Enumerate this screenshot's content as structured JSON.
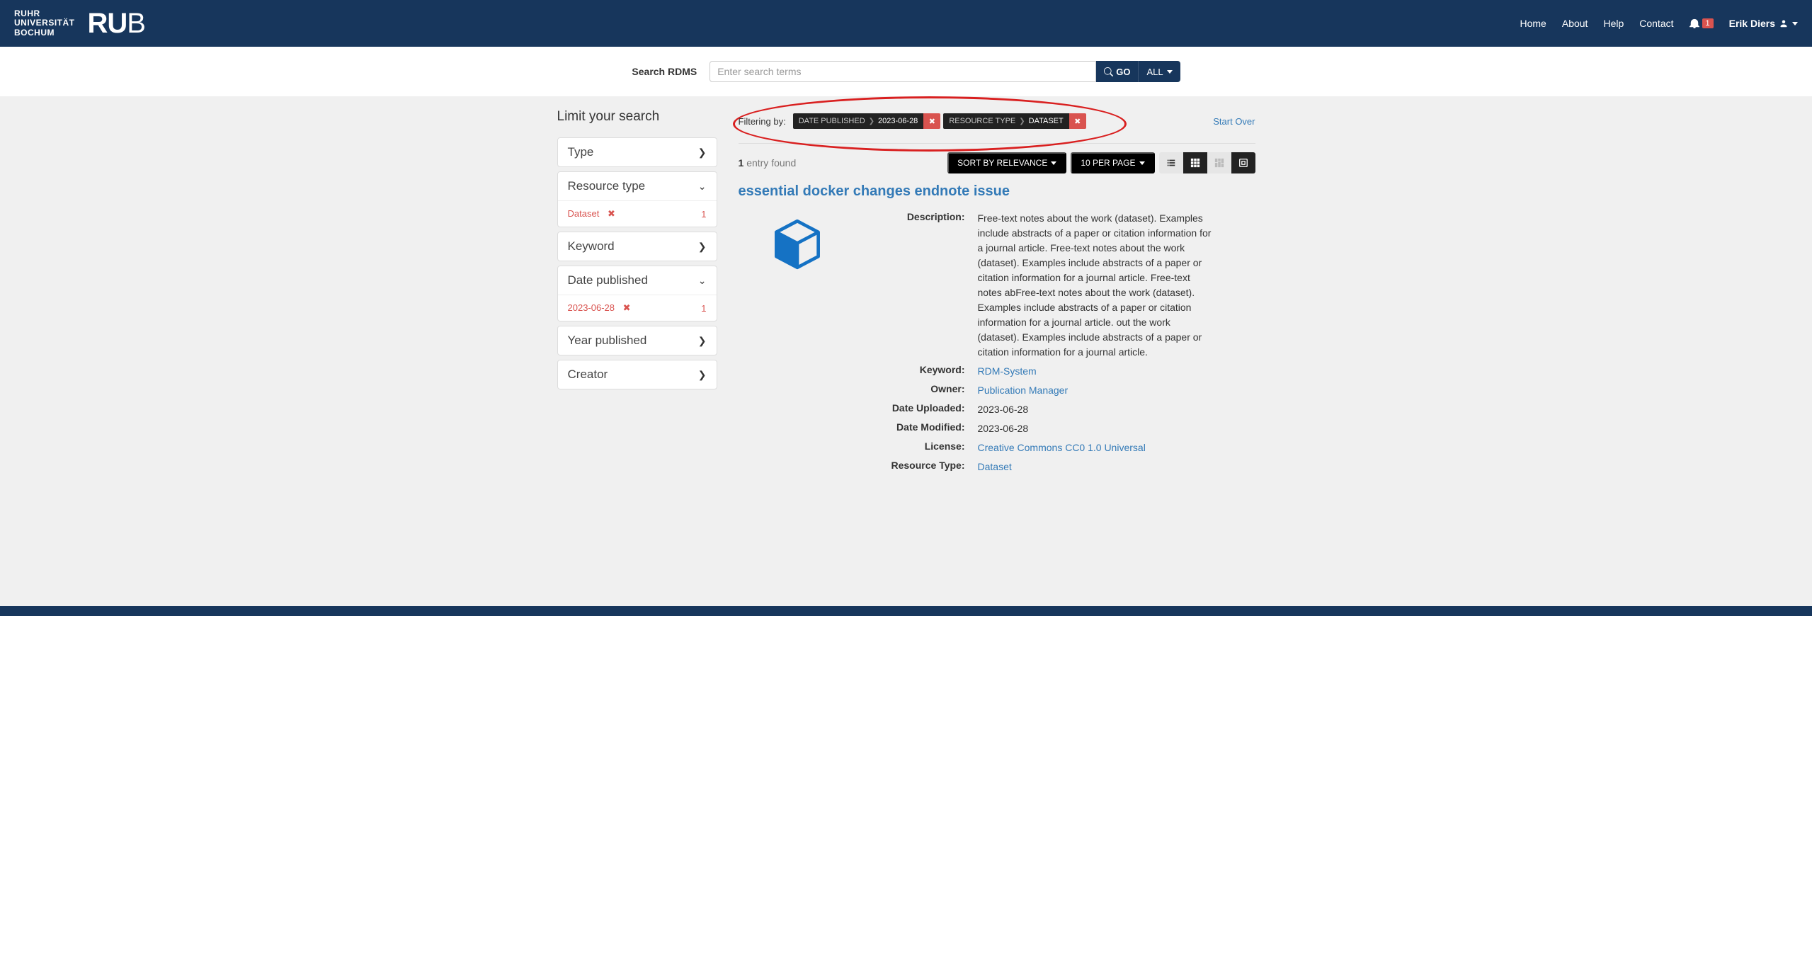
{
  "nav": {
    "university": "RUHR\nUNIVERSITÄT\nBOCHUM",
    "logo_ru": "RU",
    "logo_b": "B",
    "links": [
      "Home",
      "About",
      "Help",
      "Contact"
    ],
    "notification_count": "1",
    "user_name": "Erik Diers"
  },
  "search": {
    "label": "Search RDMS",
    "placeholder": "Enter search terms",
    "go": "GO",
    "all": "ALL"
  },
  "sidebar": {
    "title": "Limit your search",
    "facets": [
      {
        "label": "Type",
        "expanded": false
      },
      {
        "label": "Resource type",
        "expanded": true,
        "items": [
          {
            "value": "Dataset",
            "count": "1"
          }
        ]
      },
      {
        "label": "Keyword",
        "expanded": false
      },
      {
        "label": "Date published",
        "expanded": true,
        "items": [
          {
            "value": "2023-06-28",
            "count": "1"
          }
        ]
      },
      {
        "label": "Year published",
        "expanded": false
      },
      {
        "label": "Creator",
        "expanded": false
      }
    ]
  },
  "filters": {
    "label": "Filtering by:",
    "chips": [
      {
        "field": "DATE PUBLISHED",
        "value": "2023-06-28"
      },
      {
        "field": "RESOURCE TYPE",
        "value": "DATASET"
      }
    ],
    "start_over": "Start Over"
  },
  "results": {
    "count": "1",
    "entry_text": "entry found",
    "sort": "SORT BY RELEVANCE",
    "per_page": "10 PER PAGE",
    "item": {
      "title": "essential docker changes endnote issue",
      "fields": [
        {
          "label": "Description:",
          "value": "Free-text notes about the work (dataset). Examples include abstracts of a paper or citation information for a journal article. Free-text notes about the work (dataset). Examples include abstracts of a paper or citation information for a journal article. Free-text notes abFree-text notes about the work (dataset). Examples include abstracts of a paper or citation information for a journal article. out the work (dataset). Examples include abstracts of a paper or citation information for a journal article."
        },
        {
          "label": "Keyword:",
          "link": "RDM-System"
        },
        {
          "label": "Owner:",
          "link": "Publication Manager"
        },
        {
          "label": "Date Uploaded:",
          "value": "2023-06-28"
        },
        {
          "label": "Date Modified:",
          "value": "2023-06-28"
        },
        {
          "label": "License:",
          "link": "Creative Commons CC0 1.0 Universal"
        },
        {
          "label": "Resource Type:",
          "link": "Dataset"
        }
      ]
    }
  }
}
